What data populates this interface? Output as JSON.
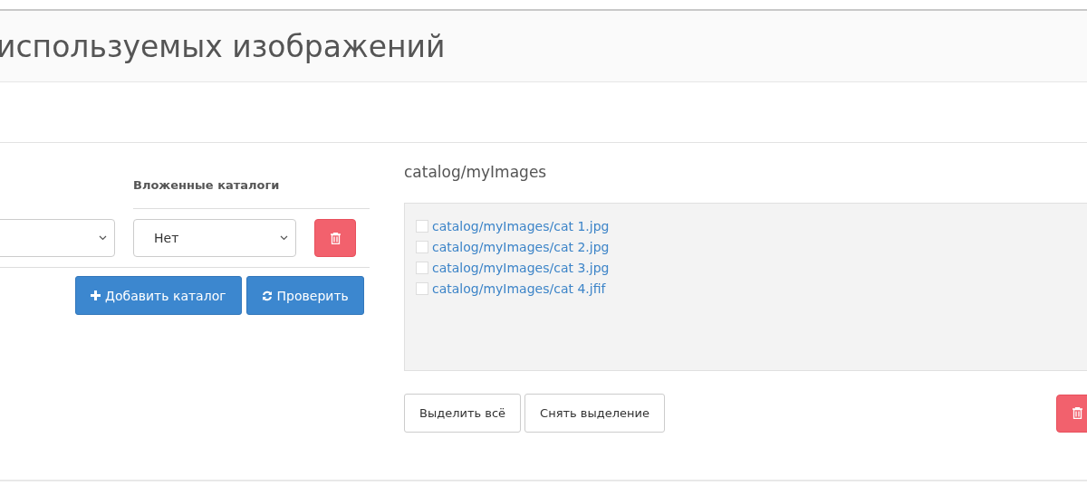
{
  "page_title": "используемых изображений",
  "catalogs": {
    "column_header": "Вложенные каталоги",
    "rows": [
      {
        "nested": "Нет"
      }
    ],
    "buttons": [
      {
        "kind": "add",
        "label": "Добавить каталог"
      },
      {
        "kind": "check",
        "label": "Проверить"
      }
    ]
  },
  "files": {
    "title": "catalog/myImages",
    "items": [
      {
        "name": "catalog/myImages/cat 1.jpg",
        "checked": false
      },
      {
        "name": "catalog/myImages/cat 2.jpg",
        "checked": false
      },
      {
        "name": "catalog/myImages/cat 3.jpg",
        "checked": false
      },
      {
        "name": "catalog/myImages/cat 4.jfif",
        "checked": false
      }
    ],
    "buttons": [
      {
        "label": "Выделить всё"
      },
      {
        "label": "Снять выделение"
      }
    ]
  }
}
